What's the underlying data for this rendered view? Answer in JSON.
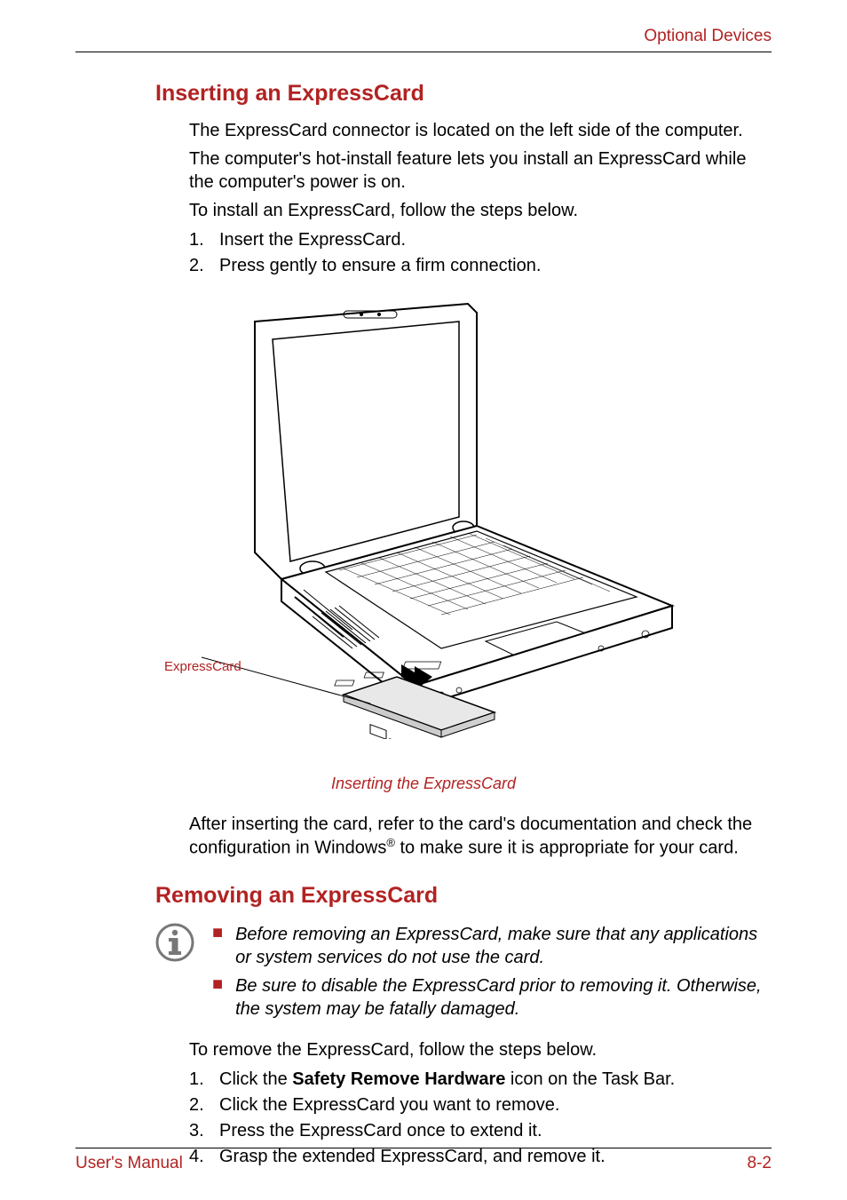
{
  "header": {
    "section": "Optional Devices"
  },
  "s1": {
    "heading": "Inserting an ExpressCard",
    "p1": "The ExpressCard connector is located on the left side of the computer.",
    "p2": "The computer's hot-install feature lets you install an ExpressCard while the computer's power is on.",
    "p3": "To install an ExpressCard, follow the steps below.",
    "steps": {
      "n1": "1.",
      "t1": "Insert the ExpressCard.",
      "n2": "2.",
      "t2": "Press gently to ensure a firm connection."
    },
    "figure": {
      "callout": "ExpressCard",
      "caption": "Inserting the ExpressCard"
    },
    "p4a": "After inserting the card, refer to the card's documentation and check the configuration in Windows",
    "p4sup": "®",
    "p4b": " to make sure it is appropriate for your card."
  },
  "s2": {
    "heading": "Removing an ExpressCard",
    "notes": {
      "b1": "Before removing an ExpressCard, make sure that any applications or system services do not use the card.",
      "b2": "Be sure to disable the ExpressCard prior to removing it. Otherwise, the system may be fatally damaged."
    },
    "p1": "To remove the ExpressCard, follow the steps below.",
    "steps": {
      "n1": "1.",
      "t1a": "Click the ",
      "t1b": "Safety Remove Hardware",
      "t1c": " icon on the Task Bar.",
      "n2": "2.",
      "t2": "Click the ExpressCard you want to remove.",
      "n3": "3.",
      "t3": "Press the ExpressCard once to extend it.",
      "n4": "4.",
      "t4": "Grasp the extended ExpressCard, and remove it."
    }
  },
  "footer": {
    "left": "User's Manual",
    "right": "8-2"
  }
}
